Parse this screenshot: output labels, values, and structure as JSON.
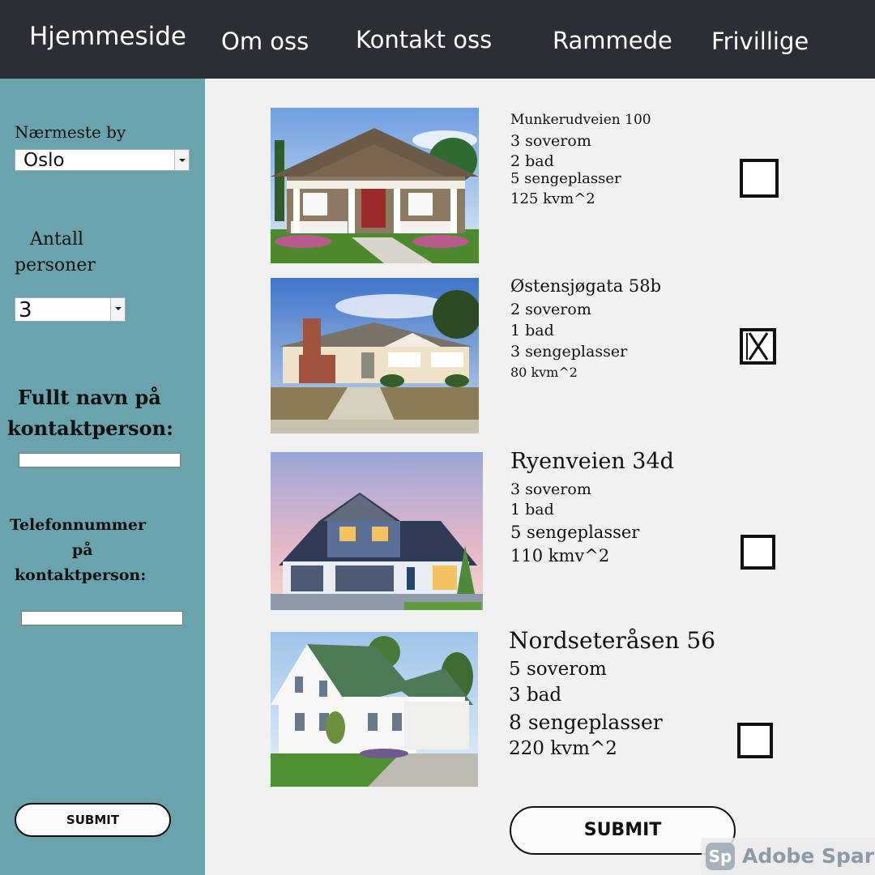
{
  "nav": {
    "items": [
      "Hjemmeside",
      "Om oss",
      "Kontakt oss",
      "Rammede",
      "Frivillige"
    ]
  },
  "sidebar": {
    "city_label": "Nærmeste by",
    "city_value": "Oslo",
    "persons_label_line1": "Antall",
    "persons_label_line2": "personer",
    "persons_value": "3",
    "fullname_label_line1": "Fullt navn på",
    "fullname_label_line2": "kontaktperson:",
    "fullname_value": "",
    "phone_label_line1": "Telefonnummer",
    "phone_label_line2": "på",
    "phone_label_line3": "kontaktperson:",
    "phone_value": "",
    "submit_label": "SUBMIT"
  },
  "listings": [
    {
      "address": "Munkerudveien 100",
      "bedrooms": "3 soverom",
      "baths": "2 bad",
      "beds": "5 sengeplasser",
      "area": "125 kvm^2",
      "checked": false
    },
    {
      "address": "Østensjøgata 58b",
      "bedrooms": "2 soverom",
      "baths": "1 bad",
      "beds": "3 sengeplasser",
      "area": "80 kvm^2",
      "checked": true
    },
    {
      "address": "Ryenveien 34d",
      "bedrooms": "3 soverom",
      "baths": "1 bad",
      "beds": "5 sengeplasser",
      "area": "110 kmv^2",
      "checked": false
    },
    {
      "address": "Nordseteråsen 56",
      "bedrooms": "5 soverom",
      "baths": "3 bad",
      "beds": "8 sengeplasser",
      "area": "220 kvm^2",
      "checked": false
    }
  ],
  "main_submit_label": "SUBMIT",
  "watermark": {
    "logo": "Sp",
    "text": "Adobe Spark"
  },
  "colors": {
    "nav_background": "#2b2f35",
    "sidebar_background": "#6ba3ad",
    "main_background": "#f1f1f1"
  },
  "icons": {
    "select_arrow": "chevron-down-icon",
    "checked_mark": "x-mark-icon"
  }
}
